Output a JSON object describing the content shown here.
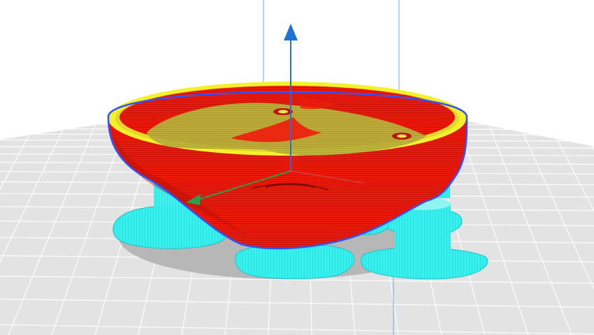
{
  "app": {
    "view": "layer-preview",
    "visible_text": []
  },
  "colors": {
    "background": "#ffffff",
    "build_plate": "#e3e3e3",
    "grid_line": "#ffffff",
    "bounding_line": "#6aa9e9",
    "axis_z": "#1e72d8",
    "axis_x": "#d04040",
    "axis_y": "#2d9d4b",
    "model_wall": "#ee1b0c",
    "model_shadow": "#b00e05",
    "model_infill": "#bcb33b",
    "model_rim": "#f3f02c",
    "support": "#37f1ee",
    "support_dark": "#22c7cc",
    "selection_outline": "#2f53ff",
    "model_shadow_plate": "#b7b7b7"
  },
  "icons": {
    "z_axis": "arrow-up-icon",
    "y_axis": "arrow-head-icon"
  }
}
